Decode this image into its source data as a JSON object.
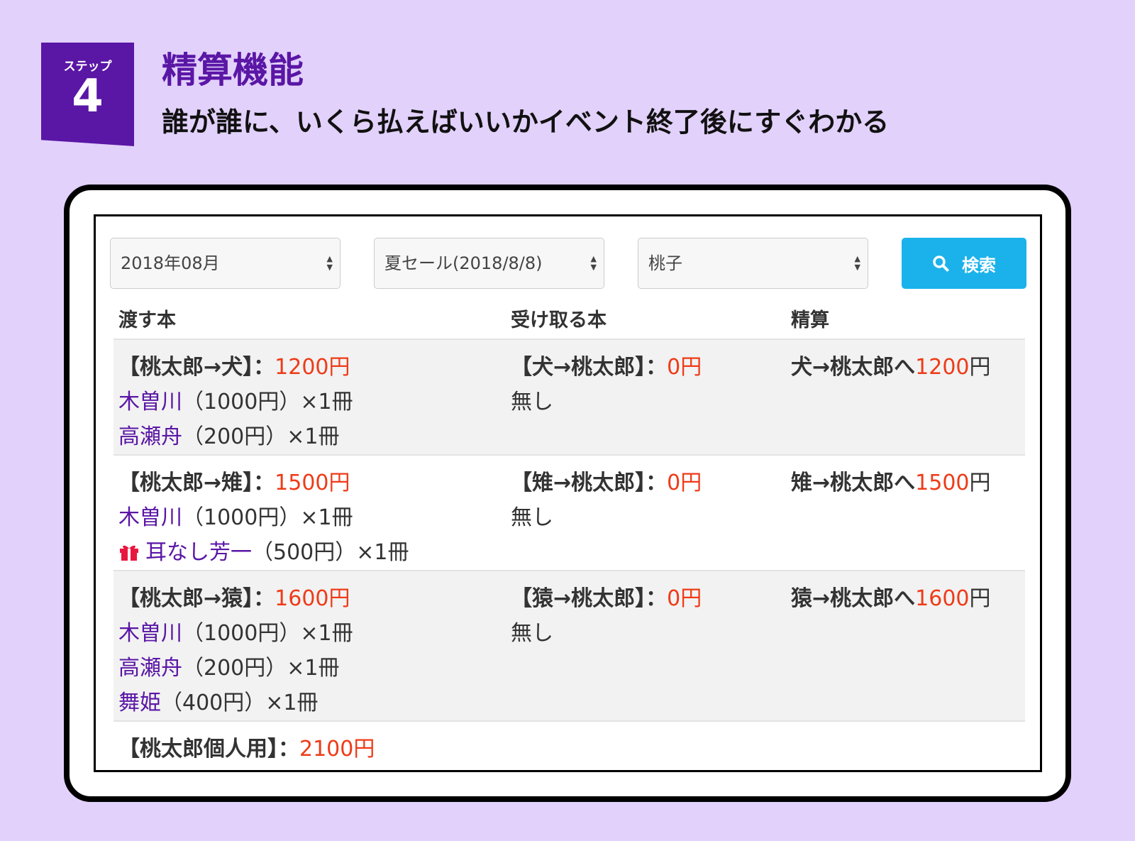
{
  "step": {
    "label": "ステップ",
    "number": "4"
  },
  "feature": {
    "title": "精算機能",
    "subtitle": "誰が誰に、いくら払えばいいかイベント終了後にすぐわかる"
  },
  "filters": {
    "month": "2018年08月",
    "event": "夏セール(2018/8/8)",
    "user": "桃子",
    "search_label": "検索"
  },
  "table": {
    "headers": {
      "give": "渡す本",
      "receive": "受け取る本",
      "settle": "精算"
    },
    "rows": [
      {
        "give_header": "【桃太郎→犬】：",
        "give_amount": "1200円",
        "give_books": [
          {
            "title": "木曽川",
            "detail": "（1000円）×1冊"
          },
          {
            "title": "高瀬舟",
            "detail": "（200円）×1冊"
          }
        ],
        "recv_header": "【犬→桃太郎】：",
        "recv_amount": "0円",
        "recv_note": "無し",
        "settle_text": "犬→桃太郎へ",
        "settle_amount": "1200",
        "settle_unit": "円"
      },
      {
        "give_header": "【桃太郎→雉】：",
        "give_amount": "1500円",
        "give_books": [
          {
            "title": "木曽川",
            "detail": "（1000円）×1冊"
          },
          {
            "title": "耳なし芳一",
            "detail": "（500円）×1冊",
            "icon": "gift-icon"
          }
        ],
        "recv_header": "【雉→桃太郎】：",
        "recv_amount": "0円",
        "recv_note": "無し",
        "settle_text": "雉→桃太郎へ",
        "settle_amount": "1500",
        "settle_unit": "円"
      },
      {
        "give_header": "【桃太郎→猿】：",
        "give_amount": "1600円",
        "give_books": [
          {
            "title": "木曽川",
            "detail": "（1000円）×1冊"
          },
          {
            "title": "高瀬舟",
            "detail": "（200円）×1冊"
          },
          {
            "title": "舞姫",
            "detail": "（400円）×1冊"
          }
        ],
        "recv_header": "【猿→桃太郎】：",
        "recv_amount": "0円",
        "recv_note": "無し",
        "settle_text": "猿→桃太郎へ",
        "settle_amount": "1600",
        "settle_unit": "円"
      },
      {
        "give_header": "【桃太郎個人用】：",
        "give_amount": "2100円"
      }
    ]
  },
  "colors": {
    "accent": "#5a16a5",
    "amount": "#ee3b18",
    "search": "#1bb2eb",
    "background": "#e2d1fb"
  }
}
